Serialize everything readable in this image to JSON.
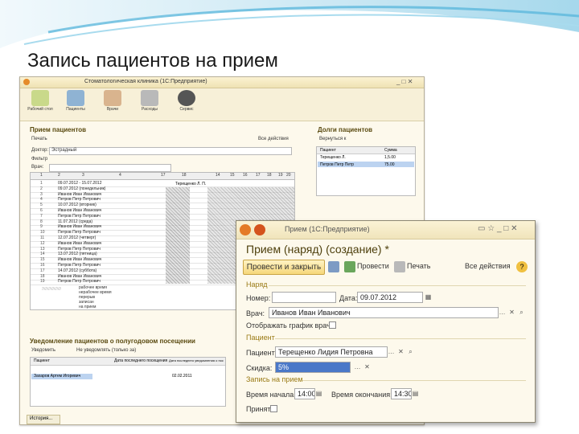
{
  "slide": {
    "title": "Запись пациентов на прием"
  },
  "main_window": {
    "title": "Стоматологическая клиника (1С:Предприятие)",
    "toolbar": [
      {
        "label": "Рабочий стол",
        "icon": "desk-icon"
      },
      {
        "label": "Пациенты",
        "icon": "patients-icon"
      },
      {
        "label": "Врачи",
        "icon": "doctor-icon"
      },
      {
        "label": "Расходы",
        "icon": "expenses-icon"
      },
      {
        "label": "Сервис",
        "icon": "gear-icon"
      }
    ],
    "reception_panel": {
      "title": "Прием пациентов",
      "add_label": "Печать",
      "all_actions": "Все действия",
      "doctor_label": "Доктор:",
      "doctor_value": "Эстрадный",
      "filter_label": "Фильтр",
      "date_label": "Врач:",
      "columns": [
        "1",
        "2",
        "3",
        "4",
        "17",
        "18",
        "14",
        "15",
        "16",
        "17",
        "18",
        "19",
        "20"
      ],
      "rows": [
        {
          "n": "1",
          "text": "09.07.2012 - 15.07.2012"
        },
        {
          "n": "2",
          "text": "09.07.2012 (понедельник)"
        },
        {
          "n": "3",
          "text": "Иванов Иван Иванович"
        },
        {
          "n": "4",
          "text": "Петров Петр Петрович"
        },
        {
          "n": "5",
          "text": "10.07.2012 (вторник)"
        },
        {
          "n": "6",
          "text": "Иванов Иван Иванович"
        },
        {
          "n": "7",
          "text": "Петров Петр Петрович"
        },
        {
          "n": "8",
          "text": "11.07.2012 (среда)"
        },
        {
          "n": "9",
          "text": "Иванов Иван Иванович"
        },
        {
          "n": "10",
          "text": "Петров Петр Петрович"
        },
        {
          "n": "11",
          "text": "12.07.2012 (четверг)"
        },
        {
          "n": "12",
          "text": "Иванов Иван Иванович"
        },
        {
          "n": "13",
          "text": "Петров Петр Петрович"
        },
        {
          "n": "14",
          "text": "13.07.2012 (пятница)"
        },
        {
          "n": "15",
          "text": "Иванов Иван Иванович"
        },
        {
          "n": "16",
          "text": "Петров Петр Петрович"
        },
        {
          "n": "17",
          "text": "14.07.2012 (суббота)"
        },
        {
          "n": "18",
          "text": "Иванов Иван Иванович"
        },
        {
          "n": "19",
          "text": "Петров Петр Петрович"
        }
      ],
      "cell_note": "Терещенко Л. П.",
      "legend": [
        "рабочее время",
        "нерабочее время",
        "перерыв",
        "записан",
        "на прием"
      ]
    },
    "debts_panel": {
      "title": "Долги пациентов",
      "action": "Вернуться к",
      "col_patient": "Пациент",
      "col_sum": "Сумма",
      "rows": [
        {
          "patient": "Терещенко Л.",
          "sum": "1,5.00"
        },
        {
          "patient": "Петров Петр Петр",
          "sum": "75.00"
        }
      ]
    },
    "notify_panel": {
      "title": "Уведомление пациентов о полугодовом посещении",
      "action1": "Уведомить",
      "action2": "Не уведомлять (только за)",
      "col1": "Пациент",
      "col2": "Дата последнего посещения",
      "col3": "Дата последнего уведомления о посещении",
      "row_patient": "Захаров Артем Игоревич",
      "row_date": "02.02.2011"
    },
    "status_tab": "История..."
  },
  "dialog": {
    "titlebar": "Прием (1С:Предприятие)",
    "title": "Прием (наряд) (создание) *",
    "post_close": "Провести и закрыть",
    "post": "Провести",
    "print": "Печать",
    "all_actions": "Все действия",
    "sec_order": "Наряд",
    "number_label": "Номер:",
    "number_value": "",
    "date_label": "Дата:",
    "date_value": "09.07.2012",
    "doctor_label": "Врач:",
    "doctor_value": "Иванов Иван Иванович",
    "show_schedule": "Отображать график врача",
    "sec_patient": "Пациент",
    "patient_label": "Пациент:",
    "patient_value": "Терещенко Лидия Петровна",
    "discount_label": "Скидка:",
    "discount_value": "5%",
    "sec_record": "Запись на прием",
    "start_label": "Время начала:",
    "start_value": "14:00",
    "end_label": "Время окончания:",
    "end_value": "14:30",
    "accepted_label": "Принят:"
  }
}
